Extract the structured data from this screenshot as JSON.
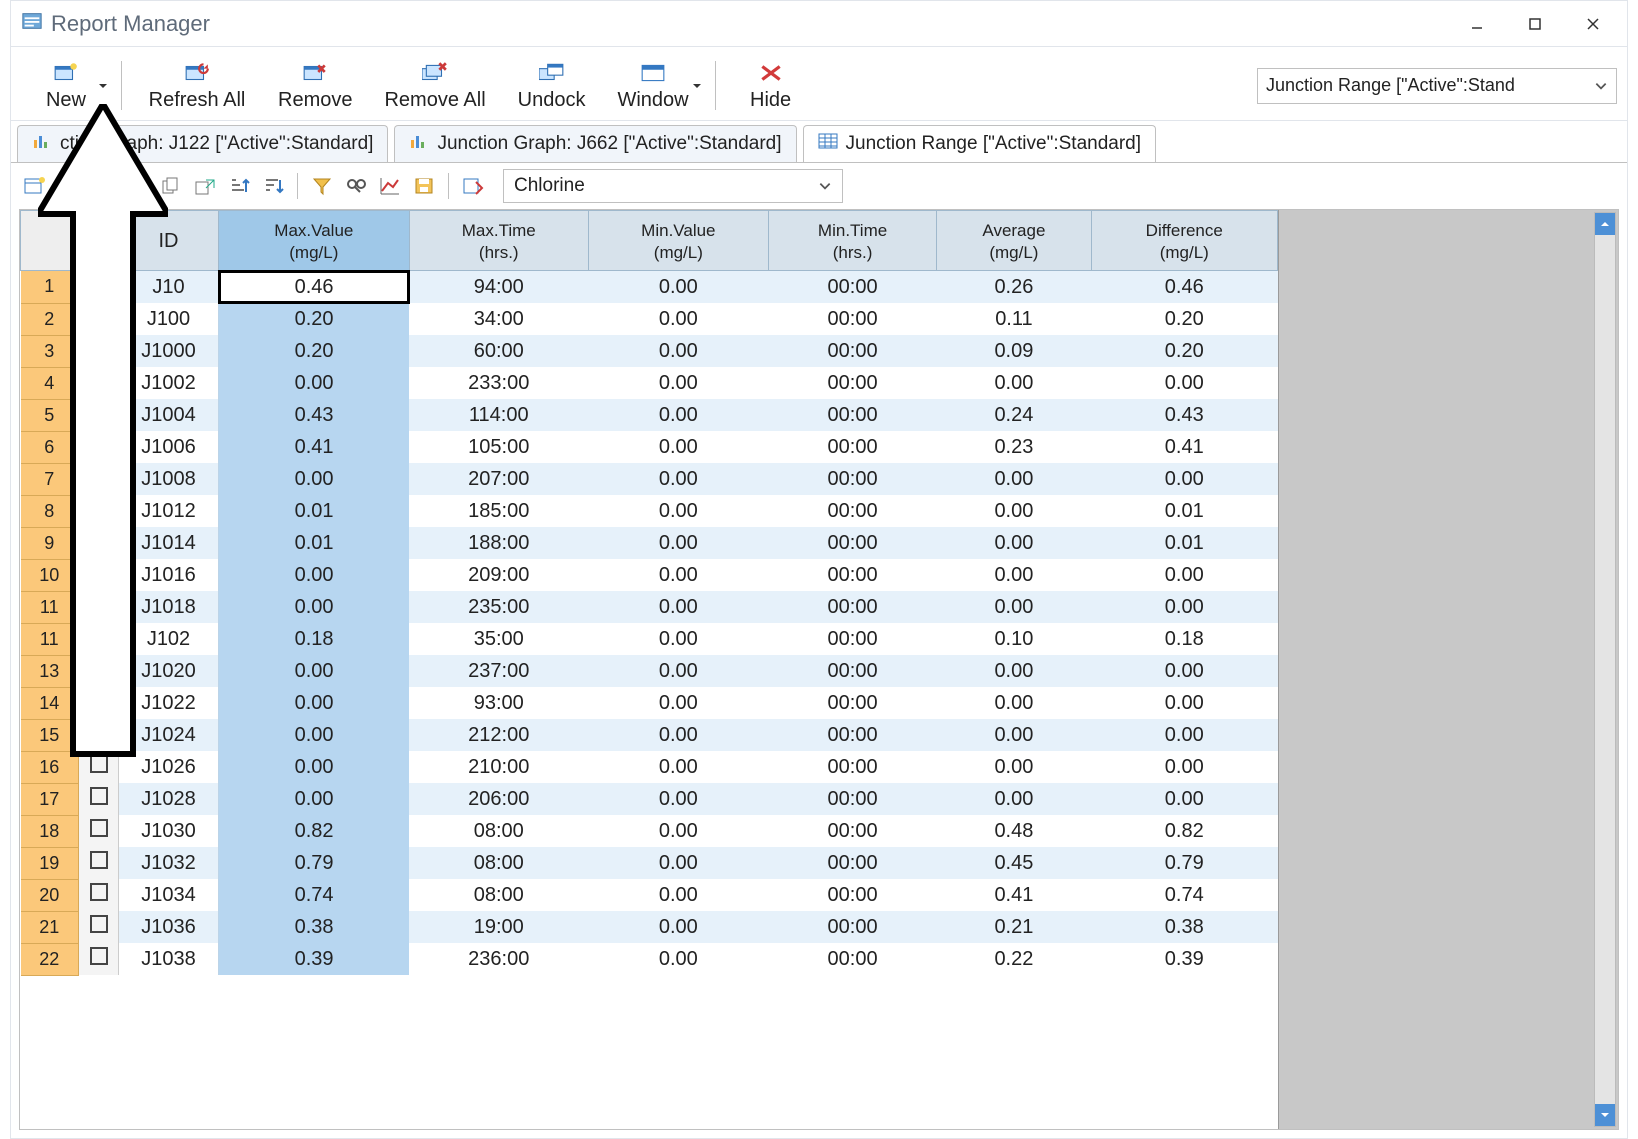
{
  "window": {
    "title": "Report Manager"
  },
  "toolbar": {
    "new_label": "New",
    "refresh_label": "Refresh All",
    "remove_label": "Remove",
    "remove_all_label": "Remove All",
    "undock_label": "Undock",
    "window_label": "Window",
    "hide_label": "Hide"
  },
  "top_combo_value": "Junction Range [\"Active\":Stand",
  "tabs": [
    {
      "label": "ction Graph: J122 [\"Active\":Standard]",
      "type": "graph",
      "active": false
    },
    {
      "label": "Junction Graph: J662 [\"Active\":Standard]",
      "type": "graph",
      "active": false
    },
    {
      "label": "Junction Range [\"Active\":Standard]",
      "type": "table",
      "active": true
    }
  ],
  "sub_toolbar": {
    "param_combo": "Chlorine"
  },
  "columns": [
    "ID",
    "Max.Value (mg/L)",
    "Max.Time (hrs.)",
    "Min.Value (mg/L)",
    "Min.Time (hrs.)",
    "Average (mg/L)",
    "Difference (mg/L)"
  ],
  "selected_cell": {
    "row_index": 0,
    "col_key": "maxv"
  },
  "rows": [
    {
      "n": 1,
      "id": "J10",
      "maxv": "0.46",
      "maxt": "94:00",
      "minv": "0.00",
      "mint": "00:00",
      "avg": "0.26",
      "diff": "0.46"
    },
    {
      "n": 2,
      "id": "J100",
      "maxv": "0.20",
      "maxt": "34:00",
      "minv": "0.00",
      "mint": "00:00",
      "avg": "0.11",
      "diff": "0.20"
    },
    {
      "n": 3,
      "id": "J1000",
      "maxv": "0.20",
      "maxt": "60:00",
      "minv": "0.00",
      "mint": "00:00",
      "avg": "0.09",
      "diff": "0.20"
    },
    {
      "n": 4,
      "id": "J1002",
      "maxv": "0.00",
      "maxt": "233:00",
      "minv": "0.00",
      "mint": "00:00",
      "avg": "0.00",
      "diff": "0.00"
    },
    {
      "n": 5,
      "id": "J1004",
      "maxv": "0.43",
      "maxt": "114:00",
      "minv": "0.00",
      "mint": "00:00",
      "avg": "0.24",
      "diff": "0.43"
    },
    {
      "n": 6,
      "id": "J1006",
      "maxv": "0.41",
      "maxt": "105:00",
      "minv": "0.00",
      "mint": "00:00",
      "avg": "0.23",
      "diff": "0.41"
    },
    {
      "n": 7,
      "id": "J1008",
      "maxv": "0.00",
      "maxt": "207:00",
      "minv": "0.00",
      "mint": "00:00",
      "avg": "0.00",
      "diff": "0.00"
    },
    {
      "n": 8,
      "id": "J1012",
      "maxv": "0.01",
      "maxt": "185:00",
      "minv": "0.00",
      "mint": "00:00",
      "avg": "0.00",
      "diff": "0.01"
    },
    {
      "n": 9,
      "id": "J1014",
      "maxv": "0.01",
      "maxt": "188:00",
      "minv": "0.00",
      "mint": "00:00",
      "avg": "0.00",
      "diff": "0.01"
    },
    {
      "n": 10,
      "id": "J1016",
      "maxv": "0.00",
      "maxt": "209:00",
      "minv": "0.00",
      "mint": "00:00",
      "avg": "0.00",
      "diff": "0.00"
    },
    {
      "n": 11,
      "id": "J1018",
      "maxv": "0.00",
      "maxt": "235:00",
      "minv": "0.00",
      "mint": "00:00",
      "avg": "0.00",
      "diff": "0.00"
    },
    {
      "n": 11,
      "id": "J102",
      "maxv": "0.18",
      "maxt": "35:00",
      "minv": "0.00",
      "mint": "00:00",
      "avg": "0.10",
      "diff": "0.18"
    },
    {
      "n": 13,
      "id": "J1020",
      "maxv": "0.00",
      "maxt": "237:00",
      "minv": "0.00",
      "mint": "00:00",
      "avg": "0.00",
      "diff": "0.00"
    },
    {
      "n": 14,
      "id": "J1022",
      "maxv": "0.00",
      "maxt": "93:00",
      "minv": "0.00",
      "mint": "00:00",
      "avg": "0.00",
      "diff": "0.00"
    },
    {
      "n": 15,
      "id": "J1024",
      "maxv": "0.00",
      "maxt": "212:00",
      "minv": "0.00",
      "mint": "00:00",
      "avg": "0.00",
      "diff": "0.00"
    },
    {
      "n": 16,
      "id": "J1026",
      "maxv": "0.00",
      "maxt": "210:00",
      "minv": "0.00",
      "mint": "00:00",
      "avg": "0.00",
      "diff": "0.00"
    },
    {
      "n": 17,
      "id": "J1028",
      "maxv": "0.00",
      "maxt": "206:00",
      "minv": "0.00",
      "mint": "00:00",
      "avg": "0.00",
      "diff": "0.00"
    },
    {
      "n": 18,
      "id": "J1030",
      "maxv": "0.82",
      "maxt": "08:00",
      "minv": "0.00",
      "mint": "00:00",
      "avg": "0.48",
      "diff": "0.82"
    },
    {
      "n": 19,
      "id": "J1032",
      "maxv": "0.79",
      "maxt": "08:00",
      "minv": "0.00",
      "mint": "00:00",
      "avg": "0.45",
      "diff": "0.79"
    },
    {
      "n": 20,
      "id": "J1034",
      "maxv": "0.74",
      "maxt": "08:00",
      "minv": "0.00",
      "mint": "00:00",
      "avg": "0.41",
      "diff": "0.74"
    },
    {
      "n": 21,
      "id": "J1036",
      "maxv": "0.38",
      "maxt": "19:00",
      "minv": "0.00",
      "mint": "00:00",
      "avg": "0.21",
      "diff": "0.38"
    },
    {
      "n": 22,
      "id": "J1038",
      "maxv": "0.39",
      "maxt": "236:00",
      "minv": "0.00",
      "mint": "00:00",
      "avg": "0.22",
      "diff": "0.39"
    }
  ]
}
